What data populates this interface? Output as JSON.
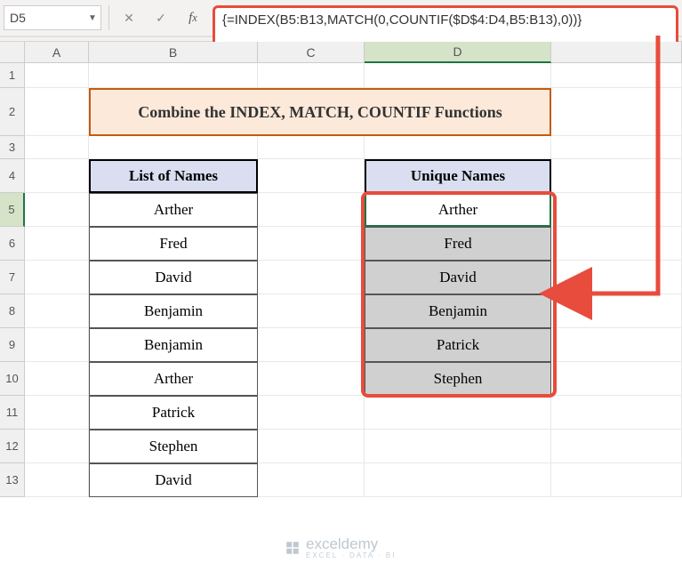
{
  "namebox": {
    "value": "D5"
  },
  "formula": "{=INDEX(B5:B13,MATCH(0,COUNTIF($D$4:D4,B5:B13),0))}",
  "title": "Combine the INDEX, MATCH, COUNTIF Functions",
  "columns": [
    "A",
    "B",
    "C",
    "D"
  ],
  "row_numbers": [
    "1",
    "2",
    "3",
    "4",
    "5",
    "6",
    "7",
    "8",
    "9",
    "10",
    "11",
    "12",
    "13"
  ],
  "headers": {
    "list": "List of Names",
    "unique": "Unique Names"
  },
  "list_names": [
    "Arther",
    "Fred",
    "David",
    "Benjamin",
    "Benjamin",
    "Arther",
    "Patrick",
    "Stephen",
    "David"
  ],
  "unique_names": [
    "Arther",
    "Fred",
    "David",
    "Benjamin",
    "Patrick",
    "Stephen"
  ],
  "watermark": {
    "brand": "exceldemy",
    "tag": "EXCEL · DATA · BI"
  },
  "chart_data": {
    "type": "table",
    "title": "Combine the INDEX, MATCH, COUNTIF Functions",
    "series": [
      {
        "name": "List of Names",
        "values": [
          "Arther",
          "Fred",
          "David",
          "Benjamin",
          "Benjamin",
          "Arther",
          "Patrick",
          "Stephen",
          "David"
        ]
      },
      {
        "name": "Unique Names",
        "values": [
          "Arther",
          "Fred",
          "David",
          "Benjamin",
          "Patrick",
          "Stephen"
        ]
      }
    ]
  }
}
